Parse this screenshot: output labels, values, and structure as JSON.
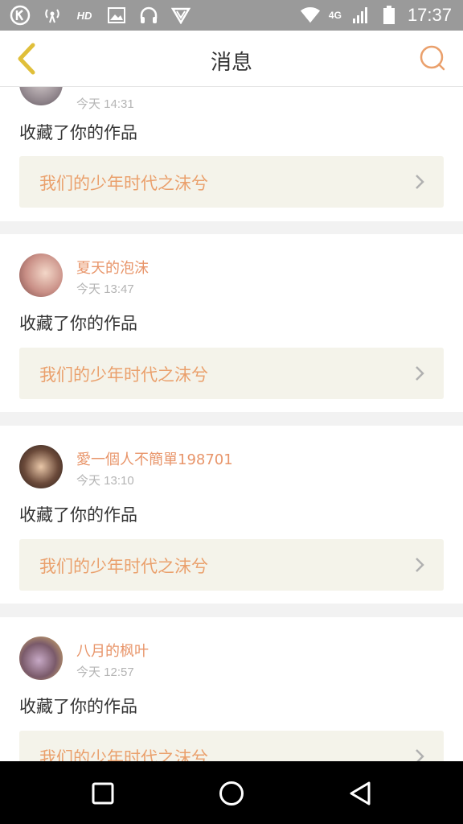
{
  "status_bar": {
    "network": "4G",
    "time": "17:37",
    "hd_label": "HD"
  },
  "header": {
    "title": "消息",
    "back_icon": "chevron-left-icon",
    "search_icon": "search-icon"
  },
  "colors": {
    "accent": "#e8956a",
    "back_arrow": "#e0bf3a",
    "card_link_bg": "#f4f3ea"
  },
  "messages": [
    {
      "username": "",
      "time": "今天 14:31",
      "action": "收藏了你的作品",
      "work_title": "我们的少年时代之沫兮"
    },
    {
      "username": "夏天的泡沫",
      "time": "今天 13:47",
      "action": "收藏了你的作品",
      "work_title": "我们的少年时代之沫兮"
    },
    {
      "username": "愛一個人不簡單198701",
      "time": "今天 13:10",
      "action": "收藏了你的作品",
      "work_title": "我们的少年时代之沫兮"
    },
    {
      "username": "八月的枫叶",
      "time": "今天 12:57",
      "action": "收藏了你的作品",
      "work_title": "我们的少年时代之沫兮"
    }
  ],
  "nav_bar": {
    "recent_icon": "square-icon",
    "home_icon": "circle-icon",
    "back_icon": "triangle-back-icon"
  }
}
